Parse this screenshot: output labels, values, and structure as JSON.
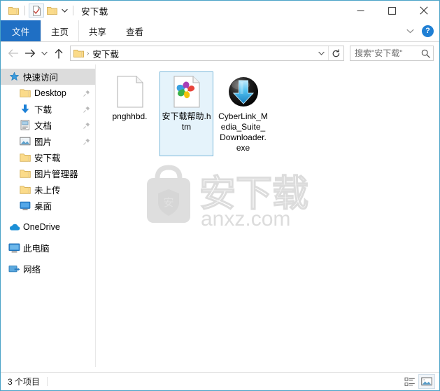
{
  "window": {
    "title": "安下载",
    "quick_access": [
      {
        "name": "folder-icon",
        "label": "属性"
      },
      {
        "name": "properties-icon",
        "label": "属性",
        "active": true
      },
      {
        "name": "new-folder-icon",
        "label": "新建文件夹"
      }
    ],
    "controls": {
      "minimize": "—",
      "maximize": "▢",
      "close": "✕"
    },
    "help_label": "?"
  },
  "ribbon": {
    "tabs": [
      {
        "label": "文件",
        "active": true
      },
      {
        "label": "主页",
        "active": false
      },
      {
        "label": "共享",
        "active": false
      },
      {
        "label": "查看",
        "active": false
      }
    ],
    "collapse_icon": "chevron-down-icon",
    "help_icon": "help-icon"
  },
  "nav": {
    "back_label": "后退",
    "forward_label": "前进",
    "history_label": "最近浏览的位置",
    "up_label": "上移到",
    "address": {
      "folder_icon": "folder-icon",
      "separator": "›",
      "crumb": "安下载",
      "dropdown_icon": "chevron-down-icon",
      "refresh_icon": "refresh-icon"
    },
    "search": {
      "placeholder": "搜索\"安下载\"",
      "value": "",
      "icon": "search-icon"
    }
  },
  "sidebar": {
    "items": [
      {
        "label": "快速访问",
        "icon": "star-icon",
        "indent": 0,
        "selected": true,
        "pinned": false
      },
      {
        "label": "Desktop",
        "icon": "folder-icon",
        "indent": 1,
        "selected": false,
        "pinned": true
      },
      {
        "label": "下载",
        "icon": "download-icon",
        "indent": 1,
        "selected": false,
        "pinned": true
      },
      {
        "label": "文档",
        "icon": "document-icon",
        "indent": 1,
        "selected": false,
        "pinned": true
      },
      {
        "label": "图片",
        "icon": "pictures-icon",
        "indent": 1,
        "selected": false,
        "pinned": true
      },
      {
        "label": "安下载",
        "icon": "folder-icon",
        "indent": 1,
        "selected": false,
        "pinned": false
      },
      {
        "label": "图片管理器",
        "icon": "folder-icon",
        "indent": 1,
        "selected": false,
        "pinned": false
      },
      {
        "label": "未上传",
        "icon": "folder-icon",
        "indent": 1,
        "selected": false,
        "pinned": false
      },
      {
        "label": "桌面",
        "icon": "desktop-icon",
        "indent": 1,
        "selected": false,
        "pinned": false
      },
      {
        "label": "OneDrive",
        "icon": "onedrive-icon",
        "indent": 0,
        "selected": false,
        "pinned": false,
        "gap": true
      },
      {
        "label": "此电脑",
        "icon": "this-pc-icon",
        "indent": 0,
        "selected": false,
        "pinned": false,
        "gap": true
      },
      {
        "label": "网络",
        "icon": "network-icon",
        "indent": 0,
        "selected": false,
        "pinned": false,
        "gap": true
      }
    ]
  },
  "files": [
    {
      "name": "pnghhbd.",
      "icon": "blank-document-icon",
      "selected": false
    },
    {
      "name": "安下载帮助.htm",
      "icon": "html-pinwheel-icon",
      "selected": true
    },
    {
      "name": "CyberLink_Media_Suite_Downloader.exe",
      "icon": "cyberlink-downloader-icon",
      "selected": false
    }
  ],
  "watermark": {
    "text": "安下载",
    "domain": "anxz.com",
    "logo_char": "安"
  },
  "statusbar": {
    "item_count": "3 个项目",
    "views": [
      {
        "name": "details-view-button",
        "label": "详细信息",
        "active": false
      },
      {
        "name": "large-icons-view-button",
        "label": "大图标",
        "active": true
      }
    ]
  },
  "colors": {
    "accent": "#1f6fc4",
    "window_border": "#4aa3c7",
    "selection_fill": "#e5f3fb",
    "selection_border": "#7ab8da",
    "folder_yellow": "#fbdb8a"
  }
}
